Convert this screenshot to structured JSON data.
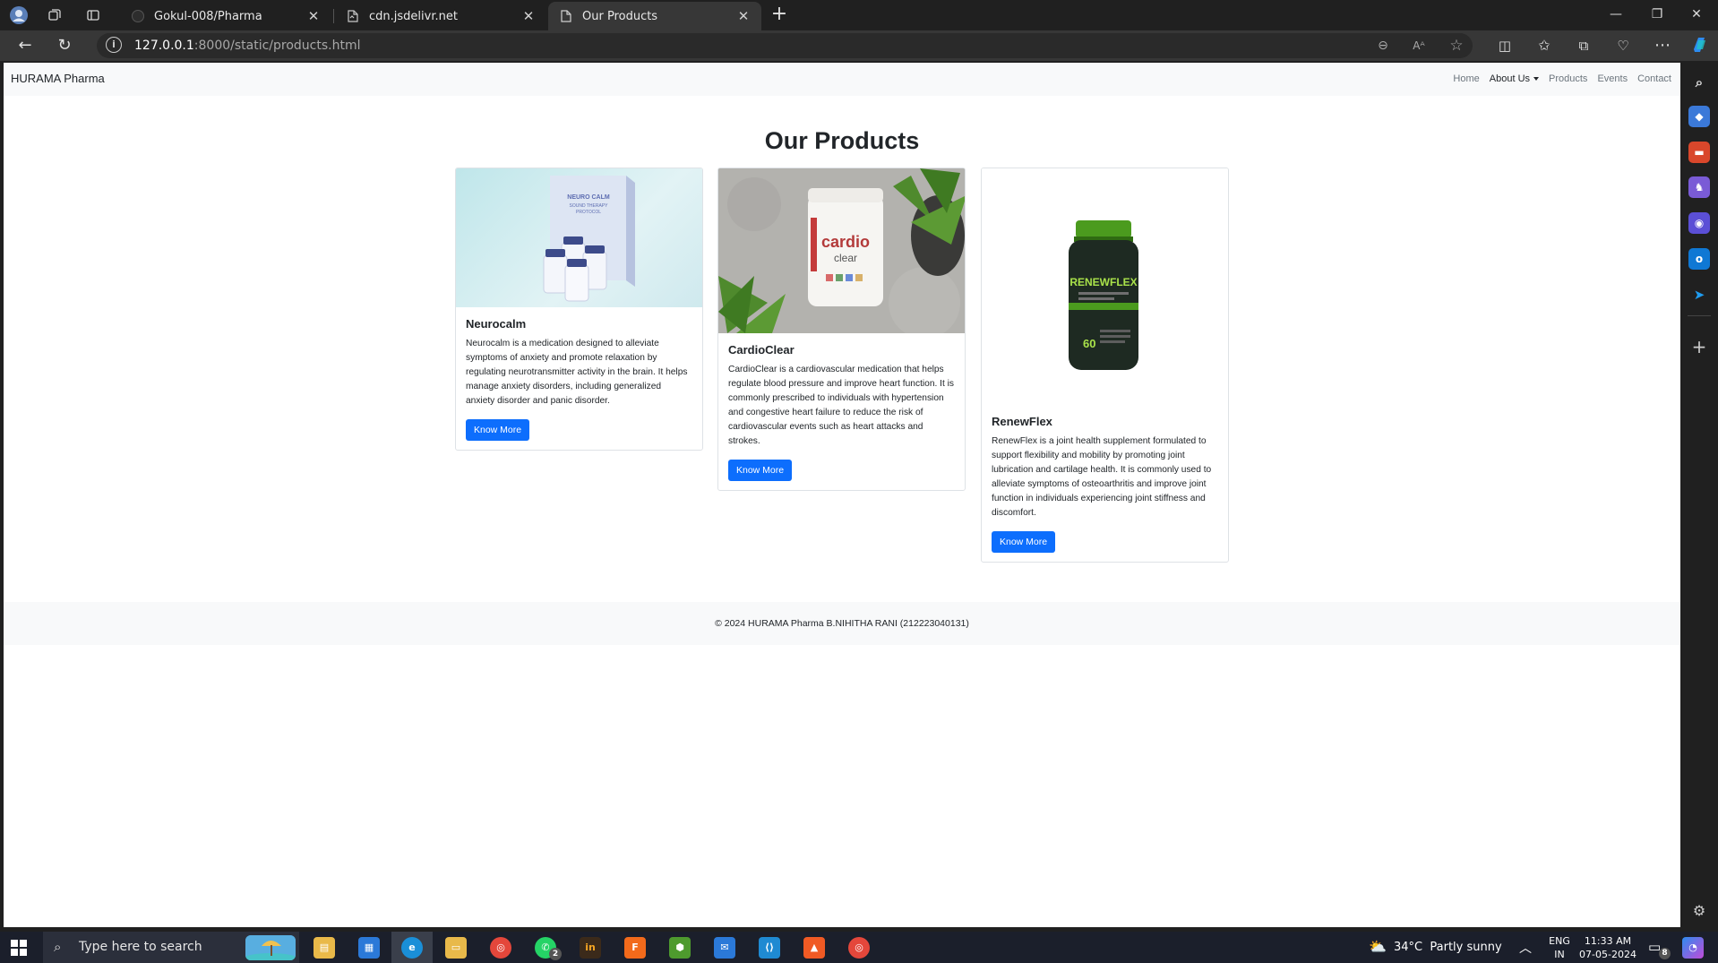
{
  "browser": {
    "tabs": [
      {
        "title": "Gokul-008/Pharma",
        "active": false
      },
      {
        "title": "cdn.jsdelivr.net",
        "active": false
      },
      {
        "title": "Our Products",
        "active": true
      }
    ],
    "url_host": "127.0.0.1",
    "url_rest": ":8000/static/products.html"
  },
  "site": {
    "brand": "HURAMA Pharma",
    "nav": [
      "Home",
      "About Us",
      "Products",
      "Events",
      "Contact"
    ],
    "heading": "Our Products",
    "products": [
      {
        "name": "Neurocalm",
        "description": "Neurocalm is a medication designed to alleviate symptoms of anxiety and promote relaxation by regulating neurotransmitter activity in the brain. It helps manage anxiety disorders, including generalized anxiety disorder and panic disorder.",
        "button": "Know More",
        "image_text": [
          "NEURO CALM",
          "SOUND THERAPY",
          "PROTOCOL"
        ]
      },
      {
        "name": "CardioClear",
        "description": "CardioClear is a cardiovascular medication that helps regulate blood pressure and improve heart function. It is commonly prescribed to individuals with hypertension and congestive heart failure to reduce the risk of cardiovascular events such as heart attacks and strokes.",
        "button": "Know More",
        "image_text": [
          "cardio",
          "clear"
        ]
      },
      {
        "name": "RenewFlex",
        "description": "RenewFlex is a joint health supplement formulated to support flexibility and mobility by promoting joint lubrication and cartilage health. It is commonly used to alleviate symptoms of osteoarthritis and improve joint function in individuals experiencing joint stiffness and discomfort.",
        "button": "Know More",
        "image_text": [
          "RENEWFLEX",
          "60"
        ]
      }
    ],
    "footer": "© 2024 HURAMA Pharma B.NIHITHA RANI (212223040131)"
  },
  "taskbar": {
    "search_placeholder": "Type here to search",
    "weather": "34°C  Partly sunny",
    "lang": "ENG",
    "region": "IN",
    "time": "11:33 AM",
    "date": "07-05-2024",
    "whatsapp_badge": "2",
    "notif_badge": "8"
  },
  "colors": {
    "primary": "#0d6efd",
    "light_bg": "#f8f9fa",
    "browser_dark": "#202020",
    "taskbar": "#1b1f2b"
  },
  "icons": [
    "back-icon",
    "refresh-icon",
    "info-icon",
    "zoom-icon",
    "read-aloud-icon",
    "favorite-icon",
    "split-icon",
    "favorites-icon",
    "collections-icon",
    "health-icon",
    "more-icon",
    "copilot-icon",
    "search-icon",
    "tag-icon",
    "tools-icon",
    "games-icon",
    "office-icon",
    "outlook-icon",
    "send-icon",
    "add-icon",
    "settings-icon"
  ]
}
